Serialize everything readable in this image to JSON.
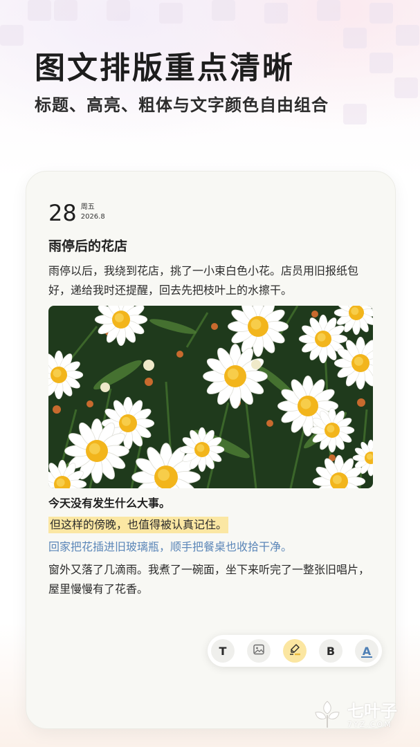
{
  "promo": {
    "headline": "图文排版重点清晰",
    "subheadline": "标题、高亮、粗体与文字颜色自由组合"
  },
  "note": {
    "date": {
      "day": "28",
      "weekday": "周五",
      "month": "2026.8"
    },
    "title": "雨停后的花店",
    "paragraph1": "雨停以后，我绕到花店，挑了一小束白色小花。店员用旧报纸包好，递给我时还提醒，回去先把枝叶上的水擦干。",
    "photo_subject": "white daisies",
    "bold_line": "今天没有发生什么大事。",
    "highlight_line": "但这样的傍晚，也值得被认真记住。",
    "blue_line": "回家把花插进旧玻璃瓶，顺手把餐桌也收拾干净。",
    "paragraph2": "窗外又落了几滴雨。我煮了一碗面，坐下来听完了一整张旧唱片，屋里慢慢有了花香。"
  },
  "toolbar": {
    "text_label": "T",
    "image_icon": "image-icon",
    "marker_icon": "highlighter-icon",
    "bold_label": "B",
    "color_label": "A"
  },
  "watermark": {
    "name": "七叶子",
    "url": "7YZ.COM"
  },
  "colors": {
    "highlight": "#fbe7a3",
    "blue_text": "#5b86b8",
    "card_bg": "#f8f8f4"
  }
}
